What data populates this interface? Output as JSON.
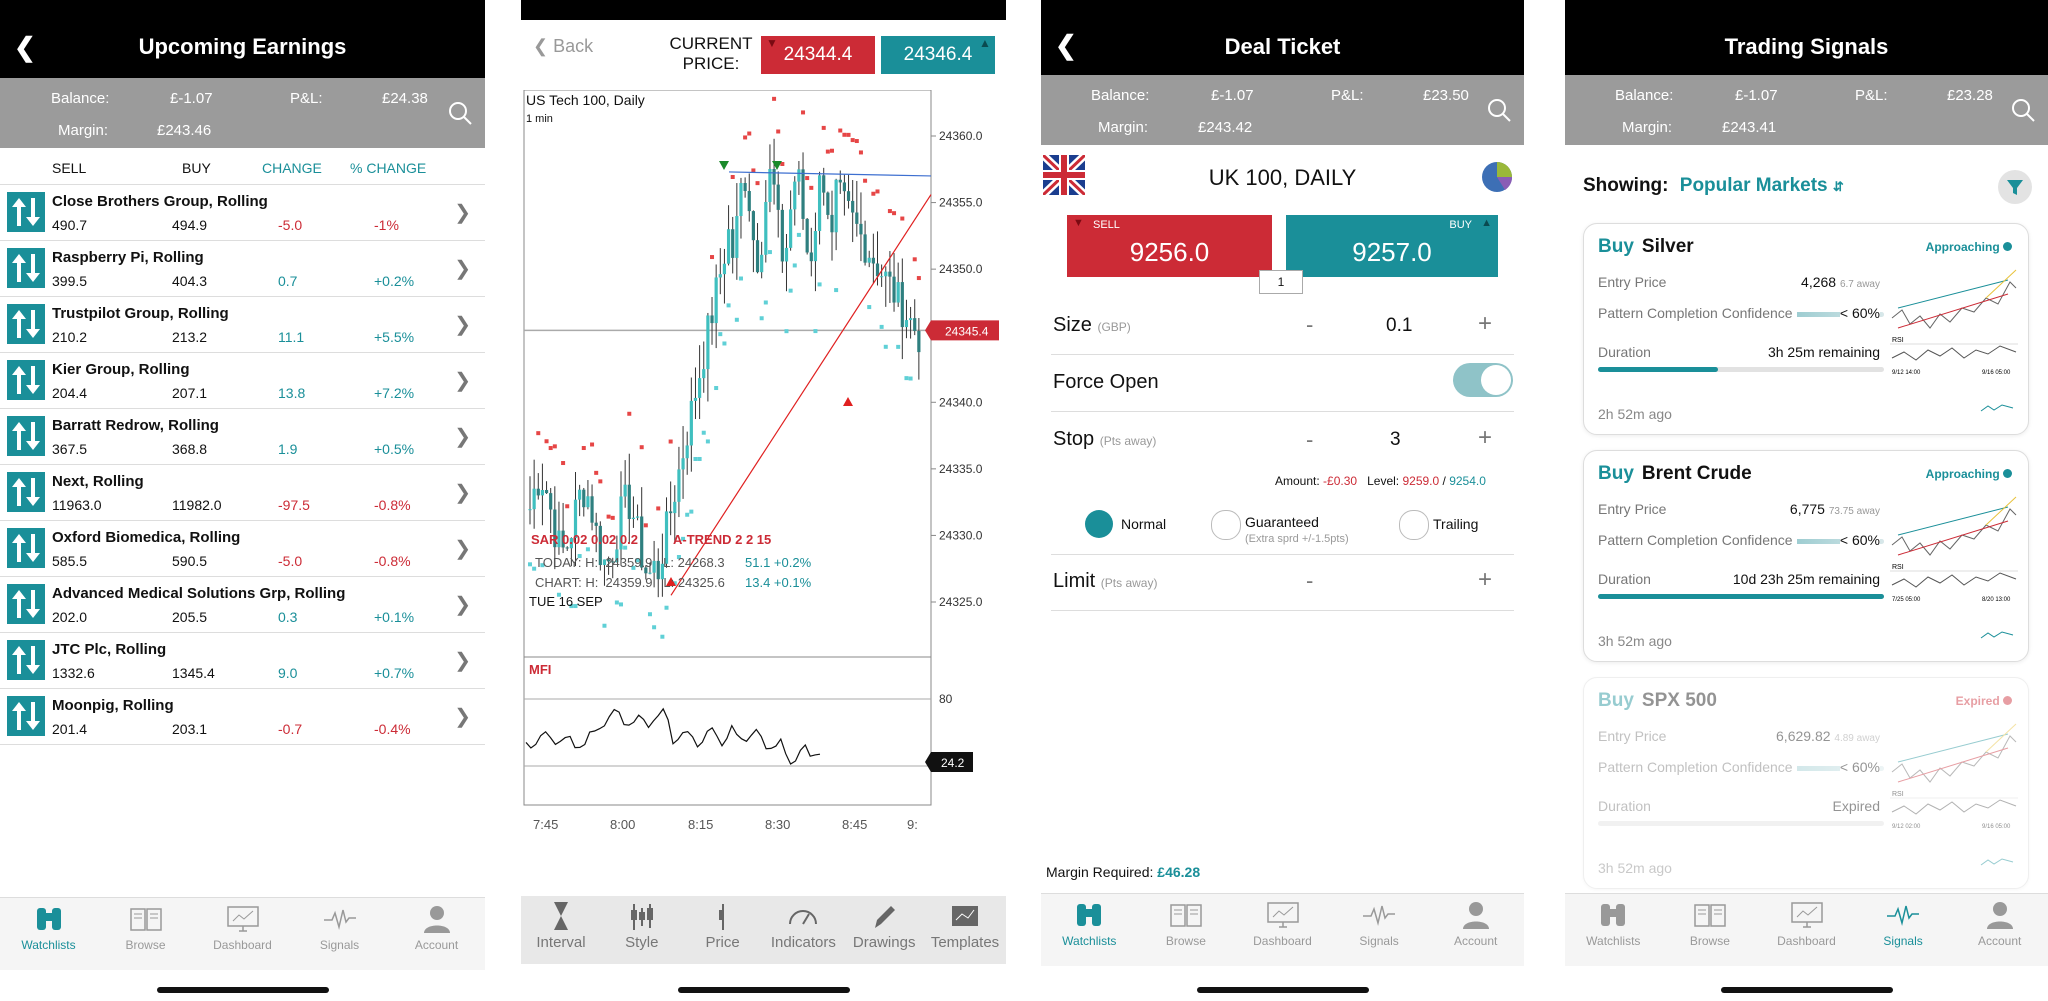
{
  "tabs": [
    {
      "label": "Watchlists",
      "icon": "binoculars-icon"
    },
    {
      "label": "Browse",
      "icon": "book-icon"
    },
    {
      "label": "Dashboard",
      "icon": "monitor-icon"
    },
    {
      "label": "Signals",
      "icon": "pulse-icon"
    },
    {
      "label": "Account",
      "icon": "person-icon"
    }
  ],
  "screen1": {
    "title": "Upcoming Earnings",
    "balance_label": "Balance:",
    "balance": "£-1.07",
    "pl_label": "P&L:",
    "pl": "£24.38",
    "margin_label": "Margin:",
    "margin": "£243.46",
    "cols": {
      "sell": "SELL",
      "buy": "BUY",
      "change": "CHANGE",
      "pct": "% CHANGE"
    },
    "rows": [
      {
        "name": "Close Brothers Group, Rolling",
        "sell": "490.7",
        "buy": "494.9",
        "change": "-5.0",
        "pct": "-1%",
        "dir": "neg"
      },
      {
        "name": "Raspberry Pi, Rolling",
        "sell": "399.5",
        "buy": "404.3",
        "change": "0.7",
        "pct": "+0.2%",
        "dir": "pos"
      },
      {
        "name": "Trustpilot Group, Rolling",
        "sell": "210.2",
        "buy": "213.2",
        "change": "11.1",
        "pct": "+5.5%",
        "dir": "pos"
      },
      {
        "name": "Kier Group, Rolling",
        "sell": "204.4",
        "buy": "207.1",
        "change": "13.8",
        "pct": "+7.2%",
        "dir": "pos"
      },
      {
        "name": "Barratt Redrow, Rolling",
        "sell": "367.5",
        "buy": "368.8",
        "change": "1.9",
        "pct": "+0.5%",
        "dir": "pos"
      },
      {
        "name": "Next, Rolling",
        "sell": "11963.0",
        "buy": "11982.0",
        "change": "-97.5",
        "pct": "-0.8%",
        "dir": "neg"
      },
      {
        "name": "Oxford Biomedica, Rolling",
        "sell": "585.5",
        "buy": "590.5",
        "change": "-5.0",
        "pct": "-0.8%",
        "dir": "neg"
      },
      {
        "name": "Advanced Medical Solutions Grp, Rolling",
        "sell": "202.0",
        "buy": "205.5",
        "change": "0.3",
        "pct": "+0.1%",
        "dir": "pos"
      },
      {
        "name": "JTC Plc, Rolling",
        "sell": "1332.6",
        "buy": "1345.4",
        "change": "9.0",
        "pct": "+0.7%",
        "dir": "pos"
      },
      {
        "name": "Moonpig, Rolling",
        "sell": "201.4",
        "buy": "203.1",
        "change": "-0.7",
        "pct": "-0.4%",
        "dir": "neg"
      }
    ],
    "active_tab": "Watchlists"
  },
  "screen2": {
    "back": "Back",
    "current_price_label": "CURRENT PRICE:",
    "sell_price": "24344.4",
    "buy_price": "24346.4",
    "chart_title": "US Tech 100, Daily",
    "interval": "1 min",
    "sar_label": "SAR  0.02  0.02  0.2",
    "atrend_label": "A-TREND  2  2  15",
    "today_label": "TODAY: H:  24359.9   L: 24268.3",
    "today_chg": "51.1  +0.2%",
    "chart_label": "CHART: H:  24359.9   L: 24325.6",
    "chart_chg": "13.4  +0.1%",
    "date_label": "TUE 16 SEP",
    "mfi_label": "MFI",
    "last_price": "24345.4",
    "mfi_value": "24.2",
    "mfi_tick": "80",
    "chart_data": {
      "type": "candlestick",
      "title": "US Tech 100, Daily",
      "y_ticks": [
        "24360.0",
        "24355.0",
        "24350.0",
        "24345.0",
        "24340.0",
        "24335.0",
        "24330.0",
        "24325.0"
      ],
      "x_ticks": [
        "7:45",
        "8:00",
        "8:15",
        "8:30",
        "8:45",
        "9:"
      ],
      "ylim": [
        24322,
        24364
      ],
      "last": 24345.4
    },
    "tools": [
      "Interval",
      "Style",
      "Price",
      "Indicators",
      "Drawings",
      "Templates"
    ]
  },
  "screen3": {
    "title": "Deal Ticket",
    "balance_label": "Balance:",
    "balance": "£-1.07",
    "pl_label": "P&L:",
    "pl": "£23.50",
    "margin_label": "Margin:",
    "margin": "£243.42",
    "market": "UK 100, DAILY",
    "sell_label": "SELL",
    "sell_price": "9256.0",
    "buy_label": "BUY",
    "buy_price": "9257.0",
    "spread": "1",
    "size_label": "Size",
    "size_unit": "(GBP)",
    "size_value": "0.1",
    "force_open": "Force Open",
    "stop_label": "Stop",
    "stop_unit": "(Pts away)",
    "stop_value": "3",
    "amount_label": "Amount:",
    "amount": "-£0.30",
    "level_label": "Level:",
    "level_sell": "9259.0",
    "level_buy": "9254.0",
    "stop_types": [
      "Normal",
      "Guaranteed",
      "Trailing"
    ],
    "guaranteed_note": "(Extra sprd +/-1.5pts)",
    "limit_label": "Limit",
    "limit_unit": "(Pts away)",
    "minus": "-",
    "plus": "+",
    "margin_required_label": "Margin Required:",
    "margin_required": "£46.28",
    "active_tab": "Watchlists"
  },
  "screen4": {
    "title": "Trading Signals",
    "balance_label": "Balance:",
    "balance": "£-1.07",
    "pl_label": "P&L:",
    "pl": "£23.28",
    "margin_label": "Margin:",
    "margin": "£243.41",
    "showing_label": "Showing:",
    "showing_value": "Popular Markets",
    "labels": {
      "entry": "Entry Price",
      "confidence": "Pattern Completion Confidence",
      "duration": "Duration",
      "buy": "Buy"
    },
    "cards": [
      {
        "market": "Silver",
        "status": "Approaching",
        "entry": "4,268",
        "away": "6.7 away",
        "confidence": "< 60%",
        "duration": "3h 25m remaining",
        "duration_fill": 0.42,
        "ago": "2h 52m ago",
        "chart_labels": [
          "RSI",
          "9/12 14:00",
          "9/16 05:00"
        ]
      },
      {
        "market": "Brent Crude",
        "status": "Approaching",
        "entry": "6,775",
        "away": "73.75 away",
        "confidence": "< 60%",
        "duration": "10d 23h 25m remaining",
        "duration_fill": 1.0,
        "ago": "3h 52m ago",
        "chart_labels": [
          "RSI",
          "7/25 05:00",
          "8/20 13:00"
        ]
      },
      {
        "market": "SPX 500",
        "status": "Expired",
        "entry": "6,629.82",
        "away": "4.89 away",
        "confidence": "< 60%",
        "duration": "Expired",
        "duration_fill": 0.0,
        "ago": "3h 52m ago",
        "chart_labels": [
          "RSI",
          "9/12 02:00",
          "9/16 05:00"
        ]
      }
    ],
    "active_tab": "Signals"
  },
  "colors": {
    "teal": "#1a8f99",
    "red": "#cc2b36",
    "gray": "#9b9b9b"
  }
}
